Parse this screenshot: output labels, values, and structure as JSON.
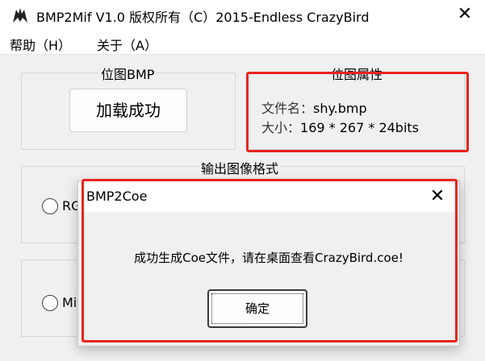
{
  "window": {
    "title": "BMP2Mif V1.0 版权所有（C）2015-Endless CrazyBird",
    "close_symbol": "✕",
    "icon": "crazybird-logo-icon"
  },
  "menu": {
    "items": [
      {
        "label": "帮助（H）"
      },
      {
        "label": "关于（A）"
      }
    ]
  },
  "bitmap_group": {
    "label": "位图BMP",
    "load_button": "加载成功"
  },
  "properties_group": {
    "label": "位图属性",
    "filename_key": "文件名：",
    "filename_value": "shy.bmp",
    "size_key": "大小：",
    "size_value": "169 * 267 * 24bits"
  },
  "output_group": {
    "label": "输出图像格式",
    "options": [
      {
        "label": "RGB"
      },
      {
        "label": "Mif"
      }
    ]
  },
  "dialog": {
    "title": "BMP2Coe",
    "close_symbol": "✕",
    "message": "成功生成Coe文件，请在桌面查看CrazyBird.coe!",
    "ok_button": "确定"
  },
  "colors": {
    "highlight_red": "#e8241d",
    "window_bg": "#f0f0f0",
    "titlebar_bg": "#ffffff"
  }
}
